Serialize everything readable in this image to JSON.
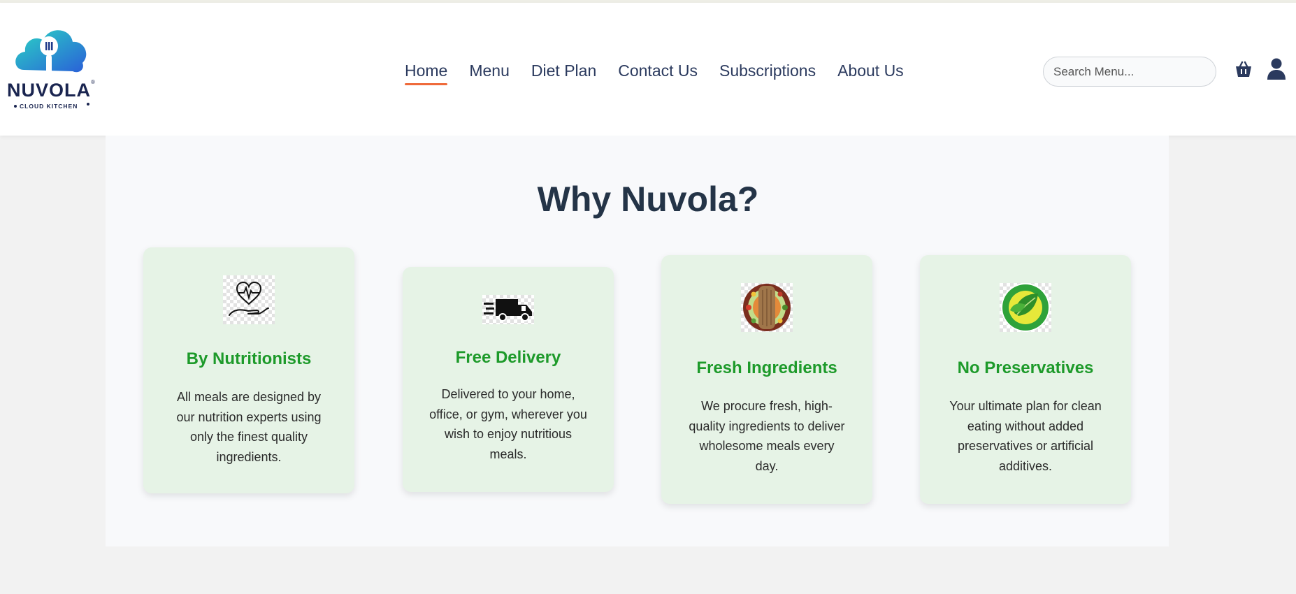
{
  "header": {
    "logo": {
      "brand": "NUVOLA",
      "tagline": "CLOUD KITCHEN"
    },
    "nav": [
      {
        "label": "Home",
        "active": true
      },
      {
        "label": "Menu",
        "active": false
      },
      {
        "label": "Diet Plan",
        "active": false
      },
      {
        "label": "Contact Us",
        "active": false
      },
      {
        "label": "Subscriptions",
        "active": false
      },
      {
        "label": "About Us",
        "active": false
      }
    ],
    "search": {
      "placeholder": "Search Menu...",
      "value": ""
    },
    "icons": {
      "cart": "basket-icon",
      "account": "user-icon"
    }
  },
  "section": {
    "title": "Why Nuvola?",
    "cards": [
      {
        "icon": "heart-in-hand-icon",
        "title": "By Nutritionists",
        "text": "All meals are designed by our nutrition experts using only the finest quality ingredients."
      },
      {
        "icon": "delivery-truck-icon",
        "title": "Free Delivery",
        "text": "Delivered to your home, office, or gym, wherever you wish to enjoy nutritious meals."
      },
      {
        "icon": "fresh-ingredients-icon",
        "title": "Fresh Ingredients",
        "text": "We procure fresh, high-quality ingredients to deliver wholesome meals every day."
      },
      {
        "icon": "no-preservatives-badge-icon",
        "title": "No Preservatives",
        "text": "Your ultimate plan for clean eating without added preservatives or artificial additives."
      }
    ]
  },
  "colors": {
    "nav_text": "#2b3a5e",
    "nav_active_underline": "#ef6a3a",
    "card_title": "#1d9a2a",
    "card_bg": "#e6f3e6",
    "heading": "#243447"
  }
}
